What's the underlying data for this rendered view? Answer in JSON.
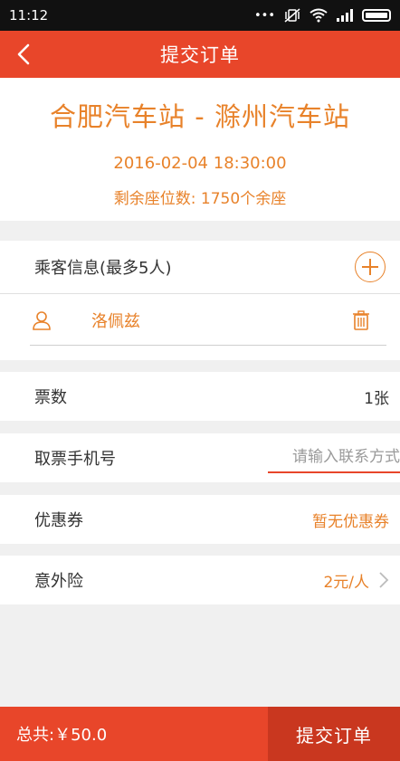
{
  "statusbar": {
    "time": "11:12",
    "icons": [
      "more-dots-icon",
      "vibrate-icon",
      "wifi-icon",
      "signal-icon",
      "battery-icon"
    ]
  },
  "nav": {
    "title": "提交订单",
    "back_icon": "back-chevron-icon"
  },
  "route": {
    "title": "合肥汽车站 - 滁州汽车站",
    "datetime": "2016-02-04 18:30:00",
    "seats": "剩余座位数: 1750个余座"
  },
  "passengers": {
    "header": "乘客信息(最多5人)",
    "list": [
      {
        "name": "洛佩兹"
      }
    ]
  },
  "tickets": {
    "label": "票数",
    "value": "1张"
  },
  "phone": {
    "label": "取票手机号",
    "placeholder": "请输入联系方式"
  },
  "coupon": {
    "label": "优惠券",
    "value": "暂无优惠券"
  },
  "insurance": {
    "label": "意外险",
    "value": "2元/人"
  },
  "footer": {
    "total": "总共:￥50.0",
    "submit_label": "提交订单"
  },
  "colors": {
    "primary": "#e8462a",
    "accent": "#e8822a",
    "submit_dark": "#c9371f"
  }
}
